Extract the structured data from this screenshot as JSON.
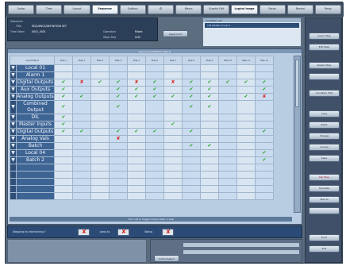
{
  "tabs": [
    {
      "label": "Scalar"
    },
    {
      "label": "Time"
    },
    {
      "label": "Layout"
    },
    {
      "label": "Sequence",
      "active": true
    },
    {
      "label": "Subfunc"
    },
    {
      "label": "ID"
    },
    {
      "label": "Macro"
    },
    {
      "label": "Graphic Edit"
    },
    {
      "label": "Logical Image",
      "active": true
    },
    {
      "label": "Route"
    },
    {
      "label": "Record"
    },
    {
      "label": "Relay"
    }
  ],
  "info": {
    "row1_label": "Sequence",
    "row2_label": "Title",
    "row2_value": "SEQUENCE/DEFINITION SET",
    "row3_label": "Time Taken",
    "row3_value": "0001_0001",
    "row3_right_label": "Operation",
    "row3_right_value": "Mixed",
    "row4_right_label": "Steps Req",
    "row4_right_value": "0/32"
  },
  "mid": {
    "button_label": "Apply Conf"
  },
  "condition": {
    "header": "Condition List",
    "selected": "Y/N    Master Group 1"
  },
  "grid": {
    "title": "Sequence Definition Matrix",
    "columns": [
      "Input/Output",
      "Step 1",
      "Step 2",
      "Step 3",
      "Step 4",
      "Step 5",
      "Step 6",
      "Step 7",
      "Step 8",
      "Step 9",
      "Step 10",
      "Step 11",
      "Step 12"
    ],
    "rows": [
      {
        "name": "Local 01",
        "cells": [
          "",
          "",
          "",
          "",
          "",
          "",
          "",
          "",
          "",
          "",
          "",
          ""
        ]
      },
      {
        "name": "Alarm 1",
        "cells": [
          "",
          "",
          "",
          "",
          "",
          "",
          "",
          "",
          "",
          "",
          "",
          ""
        ]
      },
      {
        "name": "Digital Outputs",
        "cells": [
          "ck",
          "x",
          "ck",
          "ck",
          "x",
          "ck",
          "x",
          "ck",
          "ck",
          "ck",
          "ck",
          "ck"
        ]
      },
      {
        "name": "Aux Outputs",
        "cells": [
          "ck",
          "",
          "",
          "ck",
          "ck",
          "ck",
          "",
          "ck",
          "ck",
          "",
          "",
          "ck"
        ]
      },
      {
        "name": "Analog Outputs",
        "cells": [
          "ck",
          "ck",
          "",
          "ck",
          "ck",
          "ck",
          "ck",
          "ck",
          "ck",
          "",
          "ck",
          "x"
        ]
      },
      {
        "name": "Combined Output",
        "cells": [
          "ck",
          "",
          "",
          "ck",
          "",
          "",
          "",
          "ck",
          "ck",
          "",
          "",
          ""
        ]
      },
      {
        "name": "DIL",
        "cells": [
          "ck",
          "",
          "",
          "",
          "",
          "",
          "",
          "",
          "",
          "",
          "",
          ""
        ]
      },
      {
        "name": "Master Inputs",
        "cells": [
          "ck",
          "",
          "",
          "",
          "",
          "",
          "ck",
          "",
          "",
          "",
          "",
          ""
        ]
      },
      {
        "name": "Digital Outputs",
        "cells": [
          "ck",
          "ck",
          "",
          "ck",
          "ck",
          "ck",
          "",
          "ck",
          "",
          "",
          "",
          "ck"
        ]
      },
      {
        "name": "Analog Vals",
        "cells": [
          "",
          "",
          "",
          "x",
          "",
          "",
          "",
          "",
          "",
          "",
          "",
          ""
        ]
      },
      {
        "name": "Batch",
        "cells": [
          "",
          "",
          "",
          "",
          "",
          "",
          "",
          "ck",
          "ck",
          "",
          "",
          ""
        ]
      },
      {
        "name": "Local 04",
        "cells": [
          "",
          "",
          "",
          "",
          "",
          "",
          "",
          "",
          "",
          "",
          "",
          "ck"
        ]
      },
      {
        "name": "Batch 2",
        "cells": [
          "",
          "",
          "",
          "",
          "",
          "",
          "",
          "",
          "",
          "",
          "",
          "ck"
        ]
      },
      {
        "name": "",
        "cells": [
          "",
          "",
          "",
          "",
          "",
          "",
          "",
          "",
          "",
          "",
          "",
          ""
        ]
      },
      {
        "name": "",
        "cells": [
          "",
          "",
          "",
          "",
          "",
          "",
          "",
          "",
          "",
          "",
          "",
          ""
        ]
      },
      {
        "name": "",
        "cells": [
          "",
          "",
          "",
          "",
          "",
          "",
          "",
          "",
          "",
          "",
          "",
          ""
        ]
      },
      {
        "name": "",
        "cells": [
          "",
          "",
          "",
          "",
          "",
          "",
          "",
          "",
          "",
          "",
          "",
          ""
        ]
      },
      {
        "name": "",
        "cells": [
          "",
          "",
          "",
          "",
          "",
          "",
          "",
          "",
          "",
          "",
          "",
          ""
        ]
      }
    ],
    "footer": "Click cell to toggle output state in step"
  },
  "bottom": {
    "label1": "Stepping by Interlocking ?",
    "label2": "Jump to",
    "label3": "Status"
  },
  "lower_right": {
    "button_label": "Action Select"
  },
  "sidebar": [
    "Insert Step",
    "Edit Step",
    "Delete Step",
    "",
    "Condition Edit",
    "Copy",
    "Paste",
    "Change",
    "Access",
    "Save",
    "Del Step",
    "Simulate",
    "Test All",
    "",
    "Print",
    "Exit"
  ],
  "colors": {
    "check": "#1fa31f",
    "cross": "#d81b1b",
    "accent": "#2c4e77"
  }
}
